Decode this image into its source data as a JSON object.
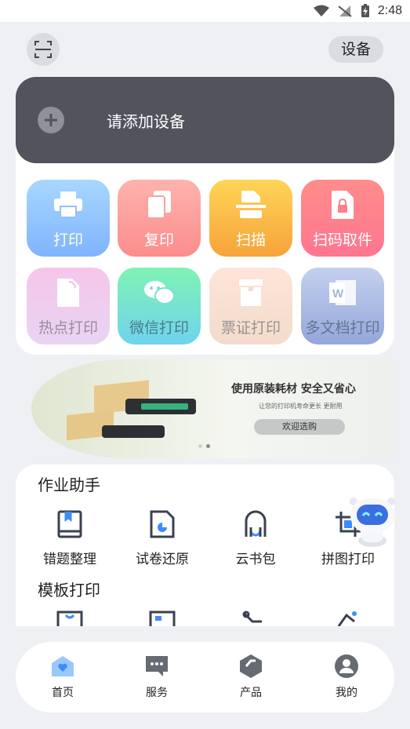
{
  "status_bar": {
    "time": "2:48"
  },
  "header": {
    "device_label": "设备"
  },
  "add_device": {
    "label": "请添加设备"
  },
  "quick_tiles": [
    {
      "label": "打印",
      "icon": "printer-icon"
    },
    {
      "label": "复印",
      "icon": "copy-icon"
    },
    {
      "label": "扫描",
      "icon": "scanner-icon"
    },
    {
      "label": "扫码取件",
      "icon": "file-lock-icon"
    },
    {
      "label": "热点打印",
      "icon": "hotspot-file-icon"
    },
    {
      "label": "微信打印",
      "icon": "wechat-icon"
    },
    {
      "label": "票证打印",
      "icon": "ticket-icon"
    },
    {
      "label": "多文档打印",
      "icon": "word-doc-icon"
    }
  ],
  "banner": {
    "headline": "使用原装耗材 安全又省心",
    "subtext": "让您的打印机寿命更长 更耐用",
    "cta": "欢迎选购",
    "active_dot": 1,
    "dot_count": 2
  },
  "homework": {
    "title": "作业助手",
    "items": [
      {
        "label": "错题整理",
        "icon": "bookmark-book-icon"
      },
      {
        "label": "试卷还原",
        "icon": "paper-restore-icon"
      },
      {
        "label": "云书包",
        "icon": "backpack-icon"
      },
      {
        "label": "拼图打印",
        "icon": "crop-icon"
      }
    ]
  },
  "templates": {
    "title": "模板打印"
  },
  "bottom_nav": [
    {
      "label": "首页",
      "icon": "home-icon",
      "active": true
    },
    {
      "label": "服务",
      "icon": "chat-bubble-icon",
      "active": false
    },
    {
      "label": "产品",
      "icon": "product-cube-icon",
      "active": false
    },
    {
      "label": "我的",
      "icon": "user-icon",
      "active": false
    }
  ],
  "colors": {
    "accent_blue": "#3d8bff",
    "add_device_bg": "#52535d",
    "page_bg": "#eef0f3"
  }
}
